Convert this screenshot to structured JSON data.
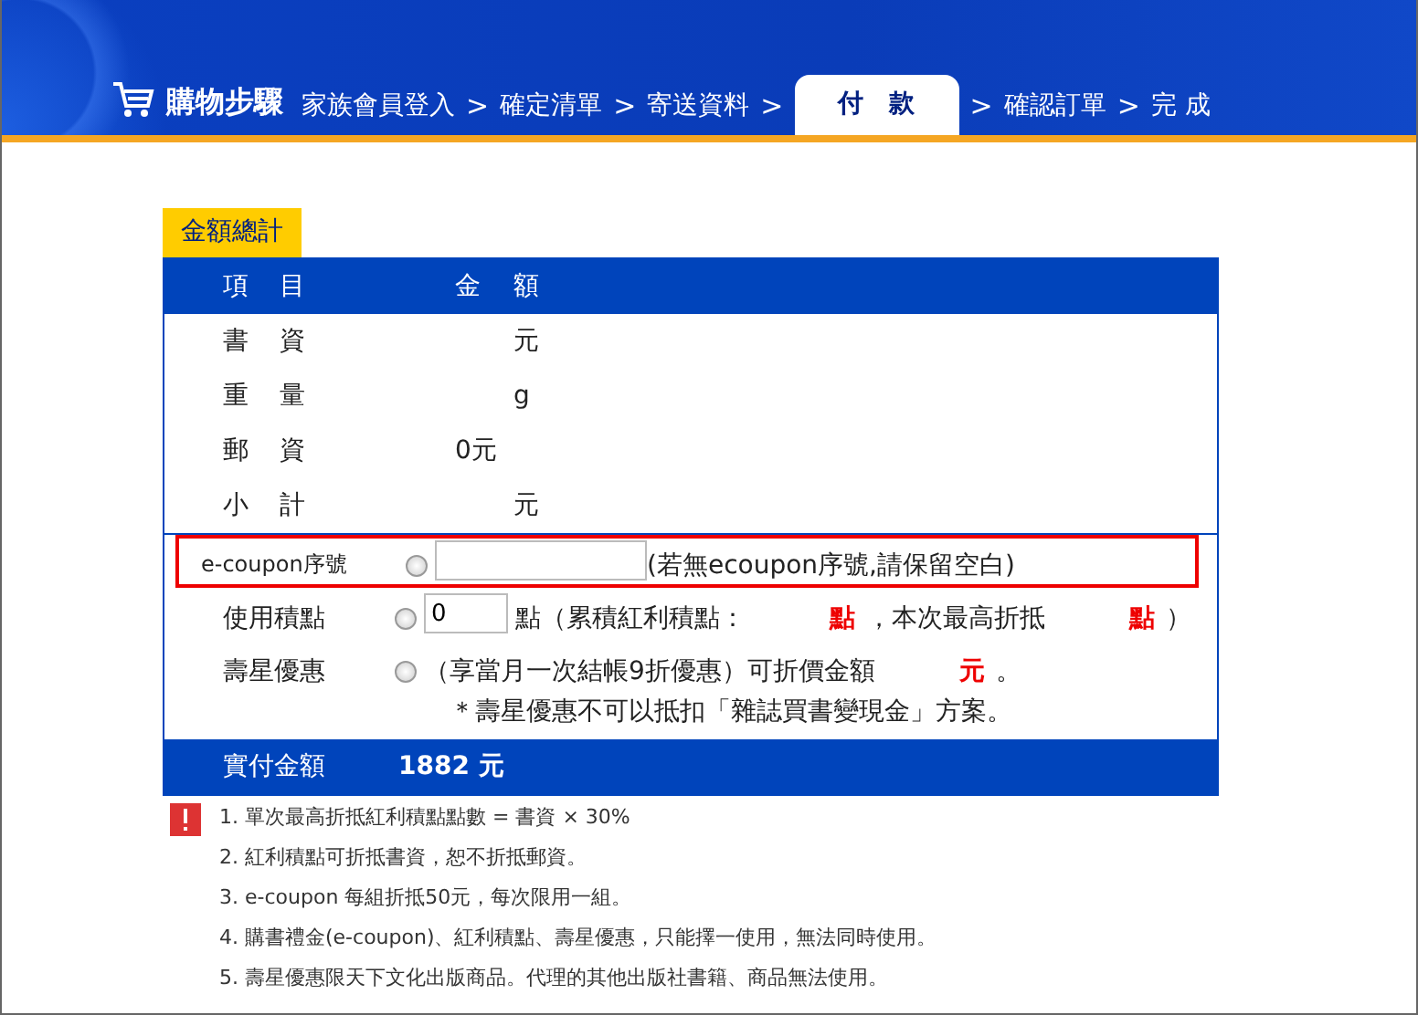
{
  "header": {
    "title": "購物步驟",
    "steps": [
      {
        "kind": "step",
        "label": "家族會員登入",
        "selected": false
      },
      {
        "kind": "separator",
        "label": ">"
      },
      {
        "kind": "step",
        "label": "確定清單",
        "selected": false
      },
      {
        "kind": "separator",
        "label": ">"
      },
      {
        "kind": "step",
        "label": "寄送資料",
        "selected": false
      },
      {
        "kind": "separator",
        "label": ">"
      },
      {
        "kind": "step",
        "label": "付　款",
        "selected": true
      },
      {
        "kind": "separator",
        "label": ">"
      },
      {
        "kind": "step",
        "label": "確認訂單",
        "selected": false
      },
      {
        "kind": "separator",
        "label": ">"
      },
      {
        "kind": "step",
        "label": "完 成",
        "selected": false
      }
    ]
  },
  "summary": {
    "title": "金額總計",
    "columns": [
      "項",
      "目",
      "金",
      "額"
    ],
    "rows": [
      {
        "label": [
          "書",
          "資"
        ],
        "unit": "元"
      },
      {
        "label": [
          "重",
          "量"
        ],
        "unit": "g"
      },
      {
        "label": [
          "郵",
          "資"
        ],
        "amount": "0元"
      },
      {
        "label": [
          "小",
          "計"
        ],
        "unit": "元"
      }
    ],
    "options": [
      {
        "kind": "coupon",
        "label": "e-coupon序號",
        "checked": false,
        "highlighted": true,
        "parts": [
          {
            "kind": "text",
            "text": "(若無ecoupon序號,請保留空白)"
          }
        ]
      },
      {
        "kind": "points",
        "label": "使用積點",
        "checked": false,
        "highlighted": false,
        "value": "0",
        "parts": [
          {
            "kind": "text",
            "text": "點（累積紅利積點："
          },
          {
            "kind": "emphasis",
            "text": "點"
          },
          {
            "kind": "text",
            "text": "，本次最高折抵"
          },
          {
            "kind": "emphasis",
            "text": "點"
          },
          {
            "kind": "text",
            "text": "）"
          }
        ]
      },
      {
        "kind": "birthday",
        "label": "壽星優惠",
        "checked": false,
        "highlighted": false,
        "parts": [
          {
            "kind": "text",
            "text": "（享當月一次結帳9折優惠）可折價金額"
          },
          {
            "kind": "emphasis",
            "text": "元"
          },
          {
            "kind": "text",
            "text": "。"
          }
        ],
        "note": "＊壽星優惠不可以抵扣「雜誌買書變現金」方案。"
      }
    ],
    "total": {
      "label": "實付金額",
      "value": "1882 元"
    }
  },
  "notes": [
    "1. 單次最高折抵紅利積點點數 = 書資 × 30%",
    "2. 紅利積點可折抵書資，恕不折抵郵資。",
    "3. e-coupon 每組折抵50元，每次限用一組。",
    "4. 購書禮金(e-coupon)、紅利積點、壽星優惠，只能擇一使用，無法同時使用。",
    "5. 壽星優惠限天下文化出版商品。代理的其他出版社書籍、商品無法使用。"
  ]
}
